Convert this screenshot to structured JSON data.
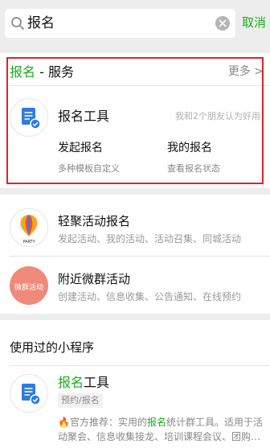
{
  "search": {
    "query": "报名",
    "cancel_label": "取消"
  },
  "service_section": {
    "keyword": "报名",
    "suffix": " - 服务",
    "more_label": "更多 >",
    "tool": {
      "title": "报名工具",
      "friends_text": "我和2个朋友认为好用",
      "actions": [
        {
          "title": "发起报名",
          "desc": "多种模板自定义"
        },
        {
          "title": "我的报名",
          "desc": "查看报名状态"
        }
      ]
    }
  },
  "results": [
    {
      "title": "轻聚活动报名",
      "desc": "发起活动、我的活动、活动召集、同城活动",
      "icon_text": "PARTY"
    },
    {
      "title": "附近微群活动",
      "desc": "创建活动、信息收集、公告通知、在线预约",
      "icon_text": "微群活动"
    }
  ],
  "used_section": {
    "header": "使用过的小程序",
    "item": {
      "title_keyword": "报名",
      "title_rest": "工具",
      "tag": "预约/报名",
      "desc_prefix": "🔥官方推荐：实用的",
      "desc_keyword": "报名",
      "desc_rest": "统计群工具。适用于活动聚会、信息收集接龙、培训课程会议、团购…"
    }
  },
  "colors": {
    "accent": "#1aad19",
    "highlight": "#e0212b",
    "icon_blue": "#2f7bde"
  }
}
